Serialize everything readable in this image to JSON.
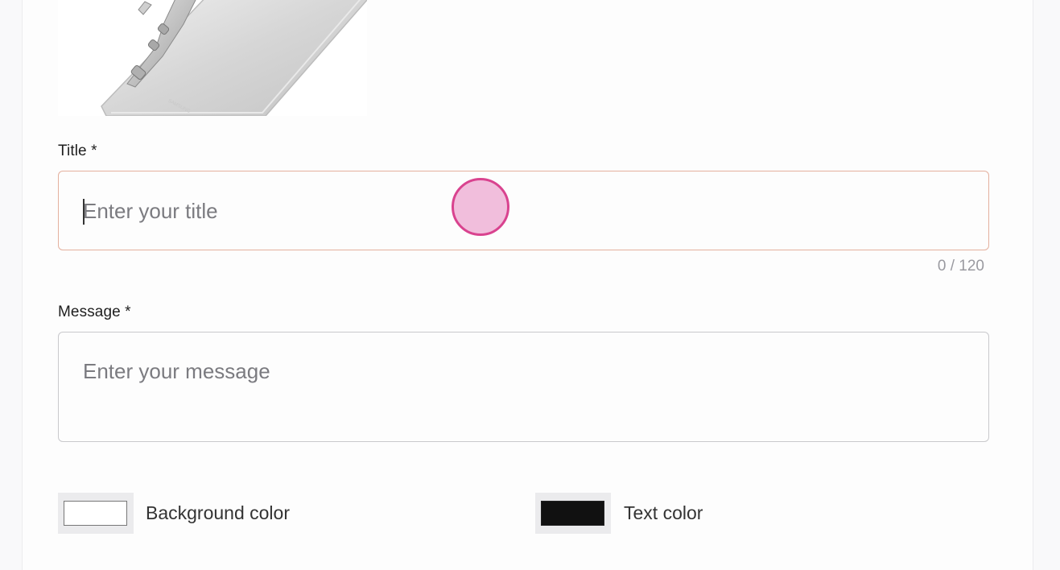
{
  "product_image": {
    "alt": "Phone product image"
  },
  "form": {
    "title": {
      "label": "Title *",
      "placeholder": "Enter your title",
      "value": "",
      "counter": "0 / 120"
    },
    "message": {
      "label": "Message *",
      "placeholder": "Enter your message",
      "value": ""
    },
    "background_color": {
      "label": "Background color",
      "value": "#ffffff"
    },
    "text_color": {
      "label": "Text color",
      "value": "#111111"
    }
  },
  "colors": {
    "title_border_focus": "#e4b09e",
    "click_marker_fill": "#f0bcd9",
    "click_marker_stroke": "#d9438f"
  }
}
